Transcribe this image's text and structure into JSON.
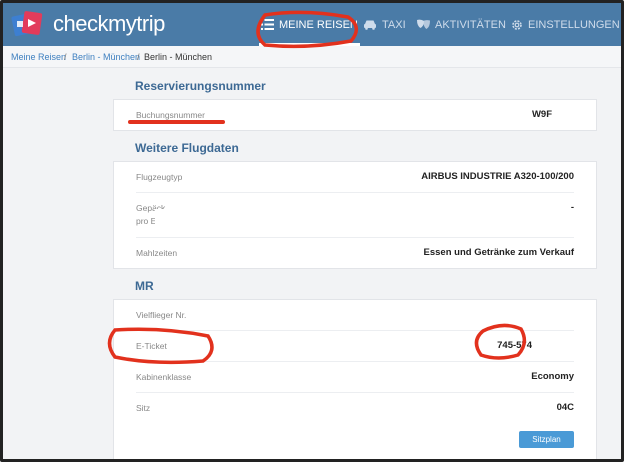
{
  "header": {
    "brand": "checkmytrip",
    "nav": [
      {
        "label": "MEINE REISEN",
        "icon": "list-icon",
        "active": true
      },
      {
        "label": "TAXI",
        "icon": "taxi-icon",
        "active": false
      },
      {
        "label": "AKTIVITÄTEN",
        "icon": "masks-icon",
        "active": false
      },
      {
        "label": "EINSTELLUNGEN",
        "icon": "gear-icon",
        "active": false
      }
    ]
  },
  "breadcrumb": {
    "items": [
      "Meine Reisen",
      "Berlin - München",
      "Berlin - München"
    ],
    "separator": "/"
  },
  "reservation": {
    "title": "Reservierungsnummer",
    "label": "Buchungsnummer",
    "value": "W9F"
  },
  "flight": {
    "title": "Weitere Flugdaten",
    "rows": [
      {
        "label": "Flugzeugtyp",
        "value": "AIRBUS INDUSTRIE A320-100/200"
      },
      {
        "label": "Gepäck",
        "label2": "pro Erwachsener",
        "value": "-"
      },
      {
        "label": "Mahlzeiten",
        "value": "Essen und Getränke zum Verkauf"
      }
    ]
  },
  "passenger": {
    "title": "MR",
    "rows": [
      {
        "label": "Vielflieger Nr.",
        "value": ""
      },
      {
        "label": "E-Ticket",
        "value": "745-574"
      },
      {
        "label": "Kabinenklasse",
        "value": "Economy"
      },
      {
        "label": "Sitz",
        "value": "04C"
      }
    ],
    "button": "Sitzplan"
  },
  "colors": {
    "header": "#4a7ba7",
    "link": "#3f80c0",
    "section_title": "#3d6994",
    "button": "#4a9ad6",
    "annotation": "#e2311d"
  }
}
